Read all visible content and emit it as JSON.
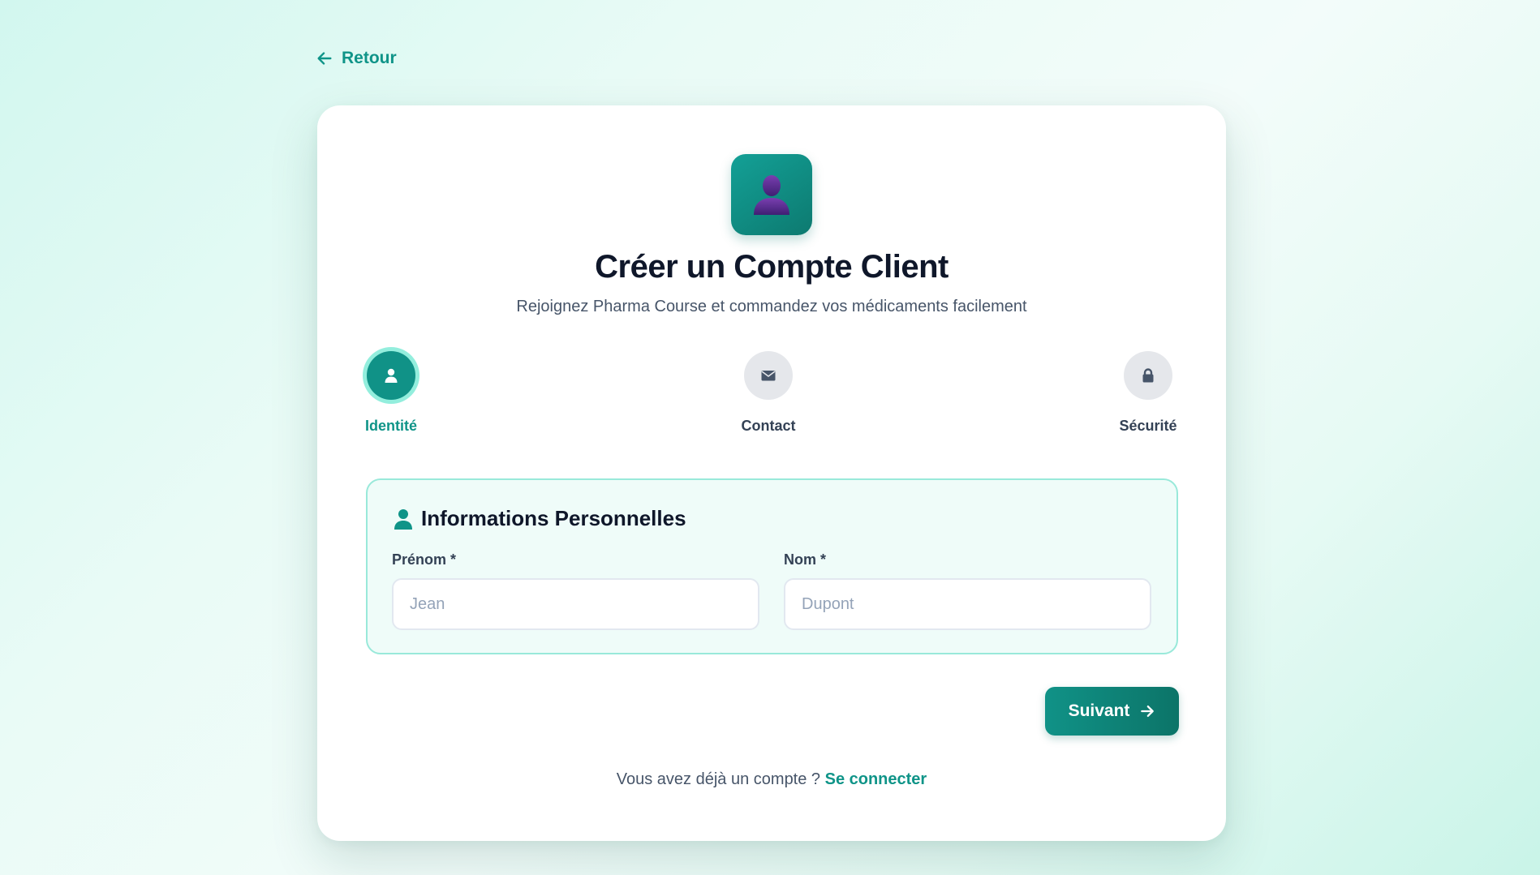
{
  "nav": {
    "back_label": "Retour"
  },
  "header": {
    "title": "Créer un Compte Client",
    "subtitle": "Rejoignez Pharma Course et commandez vos médicaments facilement"
  },
  "steps": [
    {
      "label": "Identité",
      "icon": "user-icon",
      "active": true
    },
    {
      "label": "Contact",
      "icon": "envelope-icon",
      "active": false
    },
    {
      "label": "Sécurité",
      "icon": "lock-icon",
      "active": false
    }
  ],
  "form": {
    "section_title": "Informations Personnelles",
    "first_name": {
      "label": "Prénom *",
      "placeholder": "Jean",
      "value": ""
    },
    "last_name": {
      "label": "Nom *",
      "placeholder": "Dupont",
      "value": ""
    }
  },
  "actions": {
    "next_label": "Suivant"
  },
  "footer": {
    "prompt": "Vous avez déjà un compte ? ",
    "login_link": "Se connecter"
  },
  "colors": {
    "accent": "#0f9488",
    "accent_dark": "#0c7468",
    "step_ring": "#93eedd",
    "section_bg": "#effcf9",
    "logo_figure": "#5b2a8e"
  }
}
